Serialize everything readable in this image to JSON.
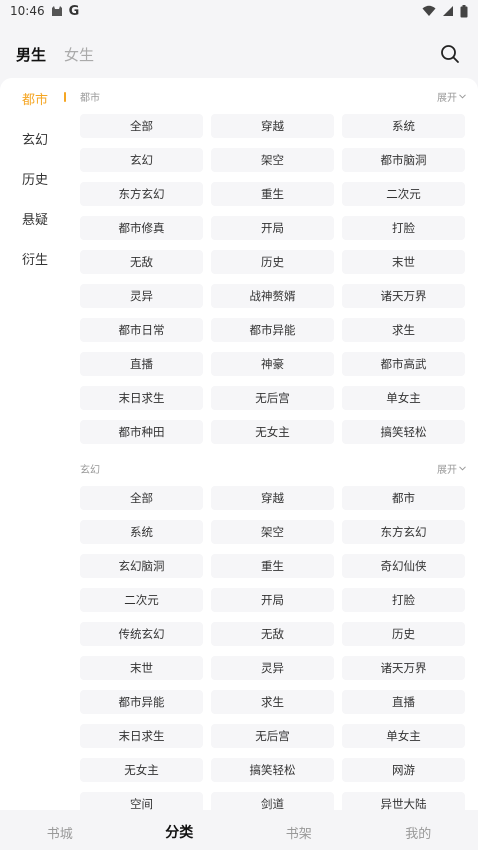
{
  "status_bar": {
    "time": "10:46",
    "g_letter": "G"
  },
  "gender_tabs": [
    {
      "label": "男生",
      "active": true
    },
    {
      "label": "女生",
      "active": false
    }
  ],
  "sidebar": [
    {
      "label": "都市",
      "active": true
    },
    {
      "label": "玄幻",
      "active": false
    },
    {
      "label": "历史",
      "active": false
    },
    {
      "label": "悬疑",
      "active": false
    },
    {
      "label": "衍生",
      "active": false
    }
  ],
  "sections": [
    {
      "title": "都市",
      "expand_label": "展开",
      "tags": [
        "全部",
        "穿越",
        "系统",
        "玄幻",
        "架空",
        "都市脑洞",
        "东方玄幻",
        "重生",
        "二次元",
        "都市修真",
        "开局",
        "打脸",
        "无敌",
        "历史",
        "末世",
        "灵异",
        "战神赘婿",
        "诸天万界",
        "都市日常",
        "都市异能",
        "求生",
        "直播",
        "神豪",
        "都市高武",
        "末日求生",
        "无后宫",
        "单女主",
        "都市种田",
        "无女主",
        "搞笑轻松"
      ]
    },
    {
      "title": "玄幻",
      "expand_label": "展开",
      "tags": [
        "全部",
        "穿越",
        "都市",
        "系统",
        "架空",
        "东方玄幻",
        "玄幻脑洞",
        "重生",
        "奇幻仙侠",
        "二次元",
        "开局",
        "打脸",
        "传统玄幻",
        "无敌",
        "历史",
        "末世",
        "灵异",
        "诸天万界",
        "都市异能",
        "求生",
        "直播",
        "末日求生",
        "无后宫",
        "单女主",
        "无女主",
        "搞笑轻松",
        "网游",
        "空间",
        "剑道",
        "异世大陆"
      ]
    }
  ],
  "bottom_nav": [
    {
      "label": "书城",
      "active": false
    },
    {
      "label": "分类",
      "active": true
    },
    {
      "label": "书架",
      "active": false
    },
    {
      "label": "我的",
      "active": false
    }
  ],
  "colors": {
    "accent": "#f5a623",
    "tag_bg": "#f6f6f8",
    "page_bg": "#f5f5f7"
  },
  "icons": {
    "search": "search-icon",
    "expand": "chevron-down-icon",
    "wifi": "wifi-icon",
    "signal": "signal-icon",
    "battery": "battery-icon",
    "cat": "cat-icon"
  }
}
